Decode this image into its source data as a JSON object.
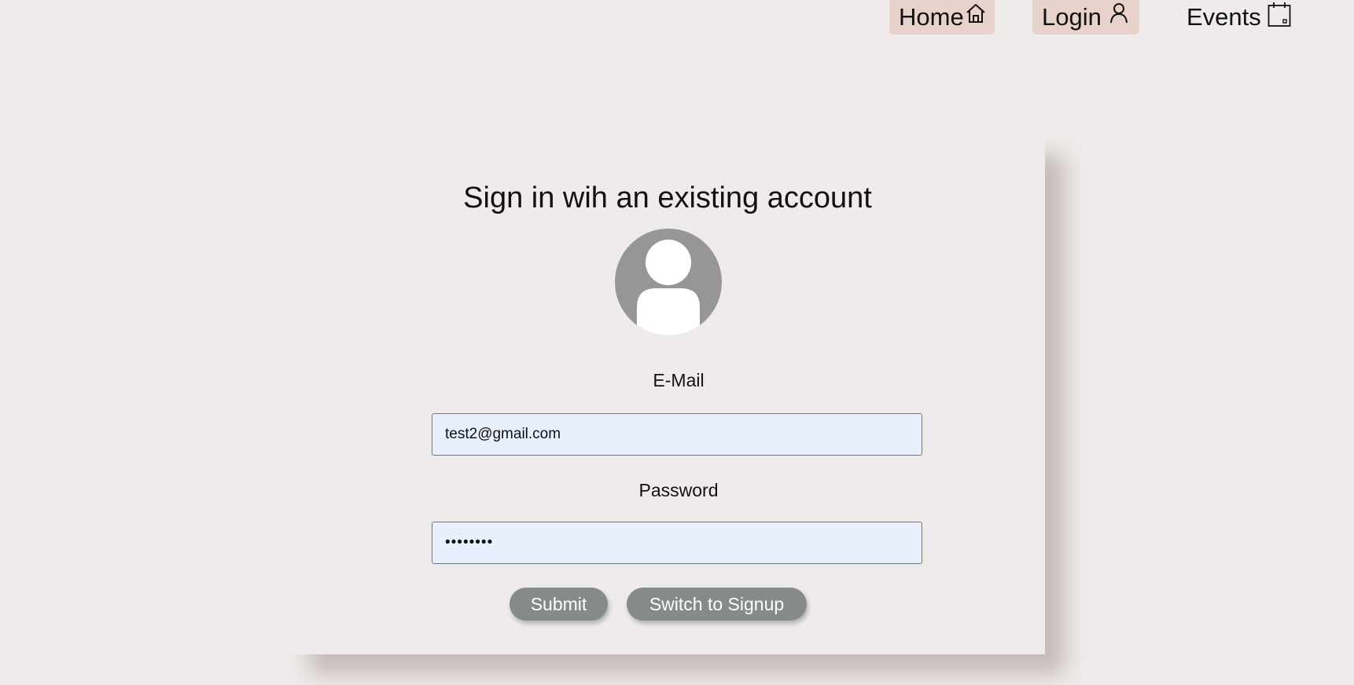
{
  "nav": {
    "items": [
      {
        "label": "Home",
        "icon": "home-icon",
        "active": true
      },
      {
        "label": "Login",
        "icon": "user-icon",
        "active": true
      },
      {
        "label": "Events",
        "icon": "calendar-icon",
        "active": false
      }
    ],
    "active_bg": "#e8d2cc"
  },
  "login": {
    "title": "Sign in wih an existing account",
    "avatar_icon": "avatar-icon",
    "email_label": "E-Mail",
    "email_value": "test2@gmail.com",
    "password_label": "Password",
    "password_value": "••••••••",
    "submit_label": "Submit",
    "switch_label": "Switch to Signup"
  },
  "colors": {
    "page_bg": "#efebea",
    "input_bg": "#e8f0fe",
    "button_bg": "#858a8b",
    "avatar_bg": "#969696"
  }
}
